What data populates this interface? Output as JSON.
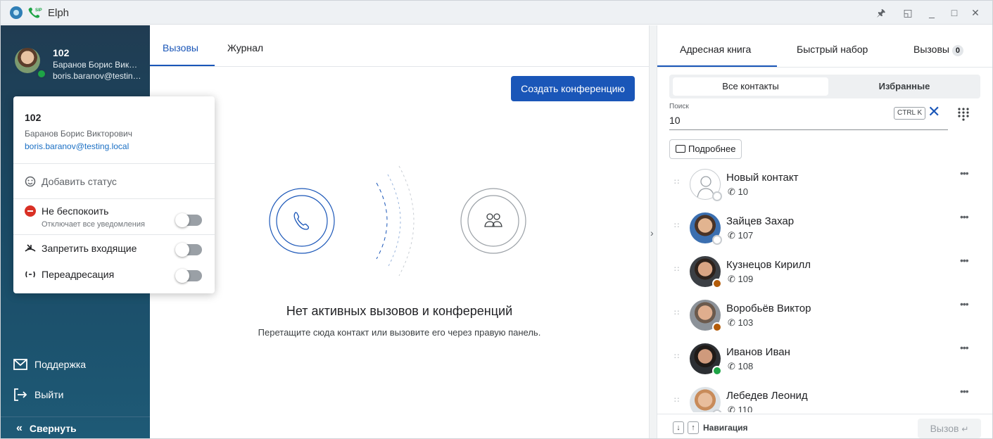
{
  "window": {
    "title": "Elph"
  },
  "user": {
    "number": "102",
    "name_short": "Баранов Борис Вик…",
    "email_short": "boris.baranov@testin…",
    "name": "Баранов Борис Викторович",
    "email": "boris.baranov@testing.local",
    "status_color": "#1ea446"
  },
  "status_menu": {
    "add_status": "Добавить статус",
    "dnd_label": "Не беспокоить",
    "dnd_sub": "Отключает все уведомления",
    "block_incoming": "Запретить входящие",
    "forwarding": "Переадресация"
  },
  "sidebar": {
    "support": "Поддержка",
    "logout": "Выйти",
    "collapse": "Свернуть"
  },
  "main": {
    "tabs": [
      {
        "label": "Вызовы"
      },
      {
        "label": "Журнал"
      }
    ],
    "create_conference": "Создать конференцию",
    "empty_title": "Нет активных вызовов и конференций",
    "empty_subtitle": "Перетащите сюда контакт или вызовите его через правую панель."
  },
  "right": {
    "tabs": [
      {
        "label": "Адресная книга"
      },
      {
        "label": "Быстрый набор"
      },
      {
        "label": "Вызовы",
        "badge": "0"
      }
    ],
    "segments": [
      "Все контакты",
      "Избранные"
    ],
    "search": {
      "label": "Поиск",
      "value": "10",
      "shortcut": "CTRL K"
    },
    "details_button": "Подробнее",
    "contacts": [
      {
        "name": "Новый контакт",
        "number": "10",
        "status_color": "#ffffff"
      },
      {
        "name": "Зайцев Захар",
        "number": "107",
        "status_color": "#ffffff"
      },
      {
        "name": "Кузнецов Кирилл",
        "number": "109",
        "status_color": "#b35c0a"
      },
      {
        "name": "Воробьёв Виктор",
        "number": "103",
        "status_color": "#b35c0a"
      },
      {
        "name": "Иванов Иван",
        "number": "108",
        "status_color": "#1ea446"
      },
      {
        "name": "Лебедев Леонид",
        "number": "110",
        "status_color": "#ffffff"
      }
    ],
    "footer": {
      "navigation": "Навигация",
      "call": "Вызов"
    }
  },
  "colors": {
    "accent": "#1a56b8",
    "sidebar_bg": "#1a4964"
  }
}
